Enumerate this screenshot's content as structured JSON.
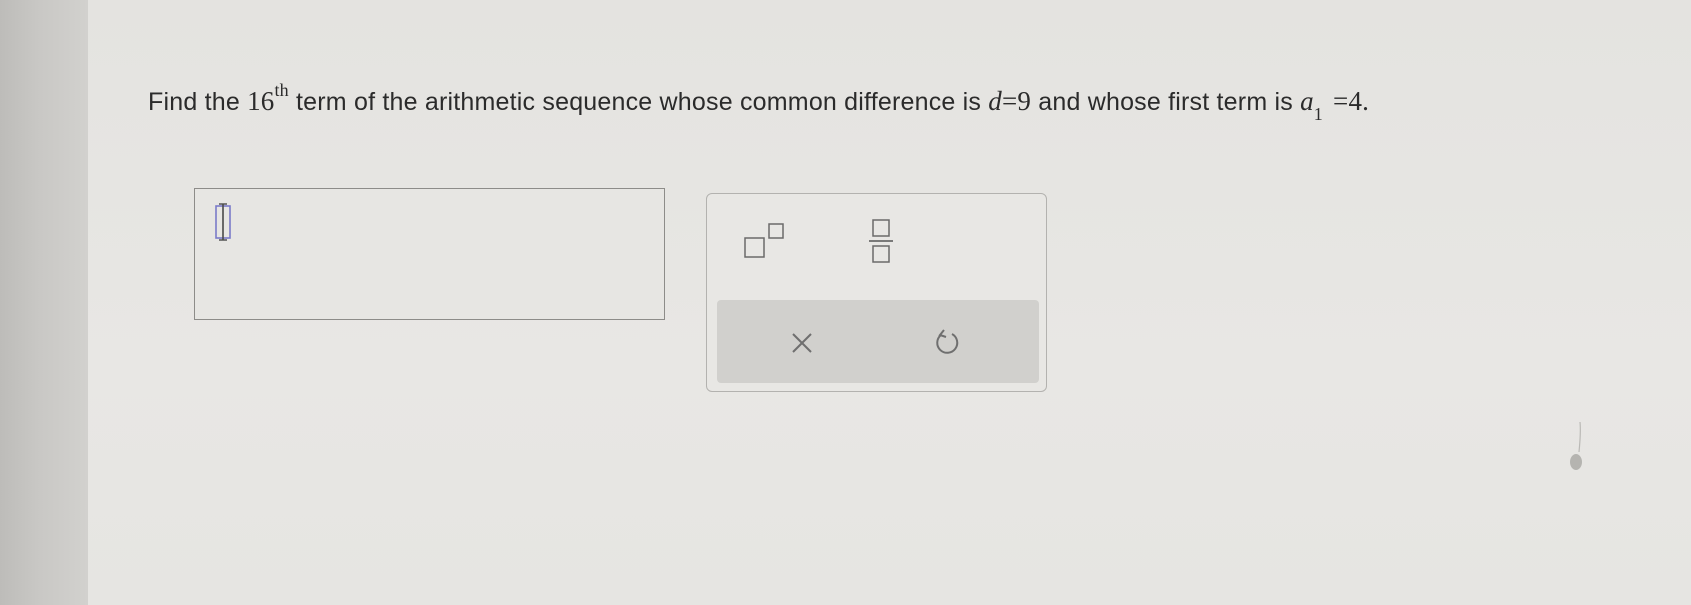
{
  "question": {
    "text_before": "Find the ",
    "term_number": "16",
    "term_suffix": "th",
    "text_middle": " term of the arithmetic sequence whose common difference is ",
    "d_symbol": "d",
    "d_equals": "=",
    "d_value": "9",
    "text_after": " and whose first term is ",
    "a_symbol": "a",
    "a_subscript": "1",
    "a_equals": "=",
    "a_value": "4."
  },
  "answer": {
    "value": ""
  },
  "keypad": {
    "keys": [
      {
        "name": "exponent",
        "icon": "superscript-icon"
      },
      {
        "name": "fraction",
        "icon": "fraction-icon"
      }
    ],
    "actions": [
      {
        "name": "clear",
        "icon": "close-icon"
      },
      {
        "name": "undo",
        "icon": "undo-icon"
      }
    ]
  },
  "colors": {
    "text": "#2b2b2b",
    "cursor_accent": "#7b7bc8",
    "keypad_border": "#b3b2af",
    "action_bar": "#d1d0cd",
    "icon_gray": "#6f6f6f"
  }
}
